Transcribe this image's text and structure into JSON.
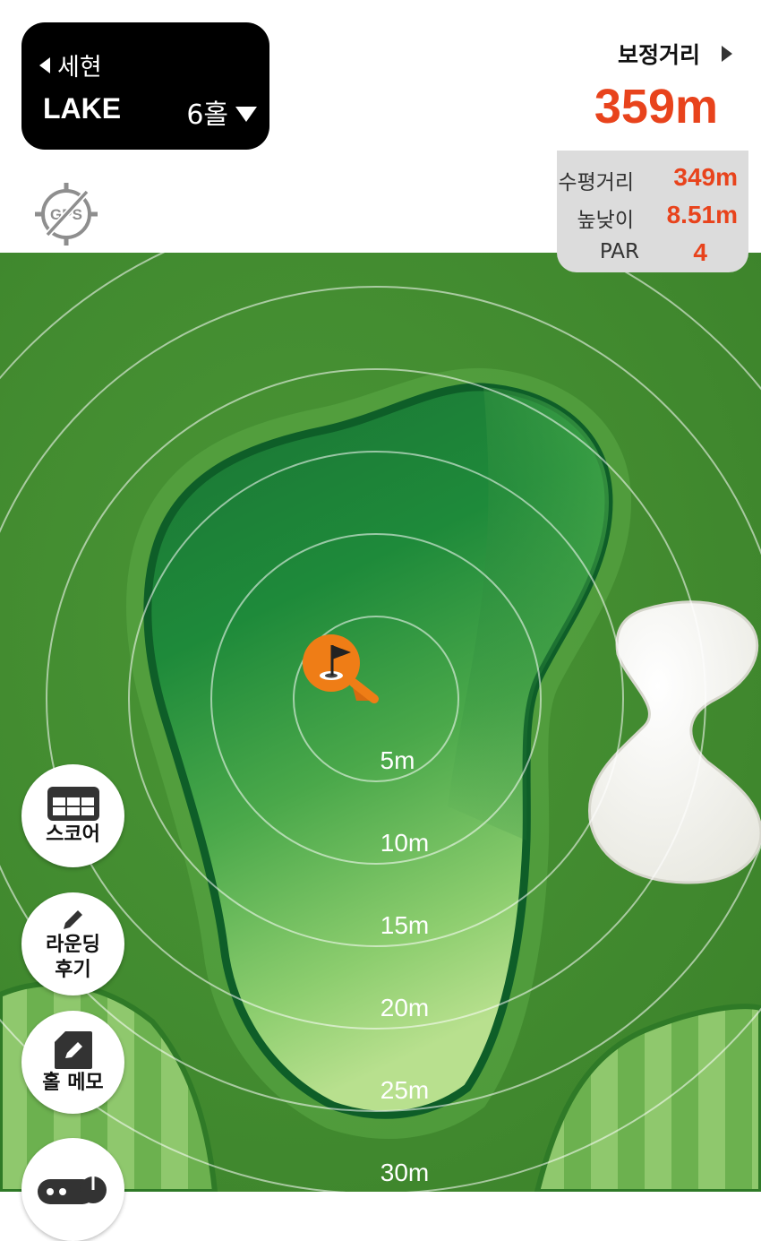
{
  "header": {
    "back_label": "세현",
    "course_name": "LAKE",
    "hole_label": "6홀"
  },
  "distance": {
    "corrected_label": "보정거리",
    "corrected_value": "359m",
    "rows": [
      {
        "label": "수평거리",
        "value": "349m"
      },
      {
        "label": "높낮이",
        "value": "8.51m"
      },
      {
        "label": "PAR",
        "value": "4"
      }
    ]
  },
  "gps": {
    "label": "GPS"
  },
  "map": {
    "ring_labels": [
      "5m",
      "10m",
      "15m",
      "20m",
      "25m",
      "30m"
    ]
  },
  "side_buttons": [
    {
      "line1": "스코어",
      "line2": "",
      "icon": "scorecard-icon"
    },
    {
      "line1": "라운딩",
      "line2": "후기",
      "icon": "pencil-icon"
    },
    {
      "line1": "홀 메모",
      "line2": "",
      "icon": "memo-icon"
    },
    {
      "line1": "",
      "line2": "",
      "icon": "gamepad-icon"
    }
  ],
  "colors": {
    "accent": "#e8431c",
    "pin": "#ef7d16",
    "rough": "#3f8a2e",
    "green_dark": "#1c7a37",
    "green_light": "#9fd27a"
  }
}
